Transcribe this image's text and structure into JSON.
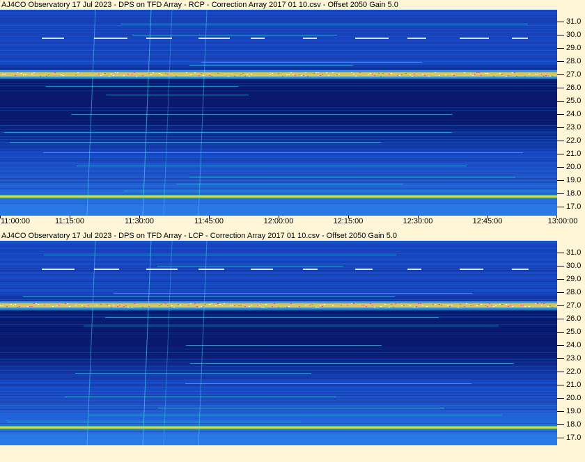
{
  "panels": [
    {
      "id": "rcp",
      "title": "AJ4CO Observatory 17 Jul 2023  -  DPS on TFD Array  -  RCP  -  Correction Array 2017 01 10.csv  -  Offset 2050  Gain 5.0",
      "y_ticks": [
        "31.0",
        "30.0",
        "29.0",
        "28.0",
        "27.0",
        "26.0",
        "25.0",
        "24.0",
        "23.0",
        "22.0",
        "21.0",
        "20.0",
        "19.0",
        "18.0",
        "17.0"
      ],
      "x_ticks": [
        "11:00:00",
        "11:15:00",
        "11:30:00",
        "11:45:00",
        "12:00:00",
        "12:15:00",
        "12:30:00",
        "12:45:00",
        "13:00:00"
      ]
    },
    {
      "id": "lcp",
      "title": "AJ4CO Observatory 17 Jul 2023  -  DPS on TFD Array  -  LCP  -  Correction Array 2017 01 10.csv  -  Offset 2050  Gain 5.0",
      "y_ticks": [
        "31.0",
        "30.0",
        "29.0",
        "28.0",
        "27.0",
        "26.0",
        "25.0",
        "24.0",
        "23.0",
        "22.0",
        "21.0",
        "20.0",
        "19.0",
        "18.0",
        "17.0"
      ],
      "x_ticks": []
    }
  ],
  "colors": {
    "background": "#fef6d6",
    "spectrogram_dark": "#0a1a6e",
    "spectrogram_mid": "#1746c4",
    "spectrogram_light": "#2a7ae8",
    "band_hot": "#ff3fa0",
    "band_warm": "#ffd24a",
    "band_green": "#7cf07a",
    "band_cyan": "#4fe0ff"
  }
}
